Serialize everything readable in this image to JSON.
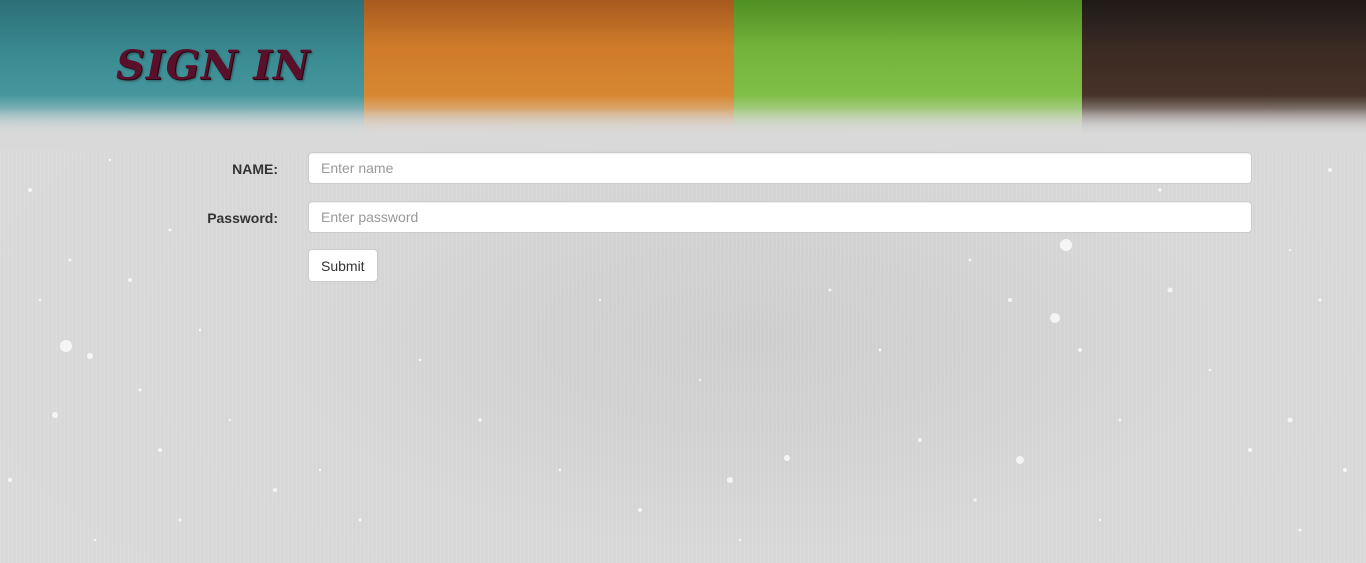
{
  "header": {
    "title": "SIGN IN"
  },
  "form": {
    "name_label": "NAME:",
    "name_placeholder": "Enter name",
    "name_value": "",
    "password_label": "Password:",
    "password_placeholder": "Enter password",
    "password_value": "",
    "submit_label": "Submit"
  },
  "colors": {
    "banner_teal": "#3a8a92",
    "banner_orange": "#cf7b2a",
    "banner_green": "#72b33a",
    "banner_brown": "#3a2a22",
    "title": "#5a0f2a",
    "background": "#d9d9d9"
  }
}
